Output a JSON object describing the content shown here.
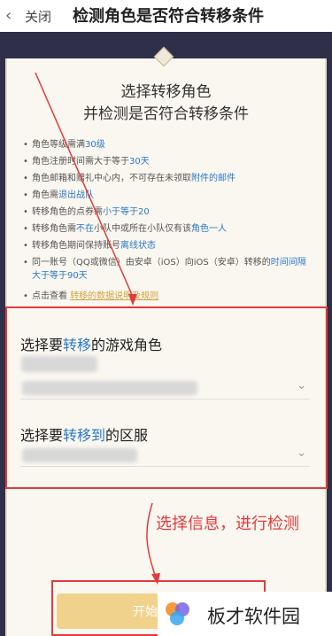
{
  "topbar": {
    "back_icon": "chevron-left",
    "close_label": "关闭",
    "title": "检测角色是否符合转移条件"
  },
  "heading": {
    "line1": "选择转移角色",
    "line2": "并检测是否符合转移条件"
  },
  "rules": [
    {
      "pre": "角色等级需满",
      "hl": "30级",
      "post": ""
    },
    {
      "pre": "角色注册时间需大于等于",
      "hl": "30天",
      "post": ""
    },
    {
      "pre": "角色邮箱和赠礼中心内，不可存在未领取",
      "hl": "附件的邮件",
      "post": ""
    },
    {
      "pre": "角色需",
      "hl": "退出战队",
      "post": ""
    },
    {
      "pre": "转移角色的点券需",
      "hl": "小于等于20",
      "post": ""
    },
    {
      "pre": "转移角色需",
      "hl": "不在",
      "post": "小队中或所在小队仅有该",
      "hl2": "角色一人"
    },
    {
      "pre": "转移角色期间保持账号",
      "hl": "离线状态",
      "post": ""
    },
    {
      "pre": "同一账号（QQ或微信）由安卓（iOS）向iOS（安卓）转移的",
      "hl": "时间间隔大于等于90天",
      "post": ""
    }
  ],
  "rule_link": {
    "pre": "点击查看",
    "link": "转移的数据说明及规则"
  },
  "select_role": {
    "pre": "选择要",
    "hl": "转移",
    "post": "的游戏角色"
  },
  "select_server": {
    "pre": "选择要",
    "hl": "转移到",
    "post": "的区服"
  },
  "annotation": "选择信息，进行检测",
  "start_button": "开始",
  "watermark": "板才软件园",
  "colors": {
    "accent_blue": "#2a78c8",
    "annotation_red": "#e13b3b",
    "button_gold": "#f1d28d"
  }
}
